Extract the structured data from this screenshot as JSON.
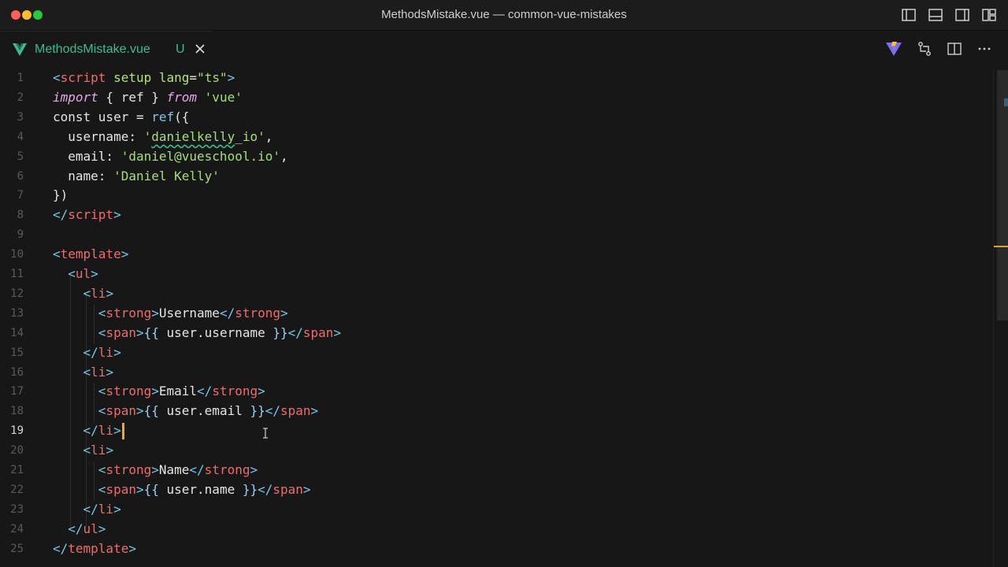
{
  "window": {
    "title": "MethodsMistake.vue — common-vue-mistakes",
    "controls": [
      "close",
      "minimize",
      "maximize"
    ],
    "layout_icons": [
      "toggle-primary-sidebar-icon",
      "toggle-panel-icon",
      "toggle-secondary-sidebar-icon",
      "customize-layout-icon"
    ]
  },
  "tab": {
    "filename": "MethodsMistake.vue",
    "status": "U",
    "icon": "vue-icon",
    "accent": "#3dbd8c"
  },
  "tab_actions": [
    "vite-icon",
    "open-changes-icon",
    "split-editor-icon",
    "more-actions-icon"
  ],
  "editor": {
    "active_line": 19,
    "lines": [
      {
        "n": "1",
        "tokens": [
          [
            "t-tag",
            "<"
          ],
          [
            "t-name",
            "script"
          ],
          [
            "t-plain",
            " "
          ],
          [
            "t-attr",
            "setup"
          ],
          [
            "t-plain",
            " "
          ],
          [
            "t-attr",
            "lang"
          ],
          [
            "t-plain",
            "="
          ],
          [
            "t-str",
            "\"ts\""
          ],
          [
            "t-tag",
            ">"
          ]
        ]
      },
      {
        "n": "2",
        "tokens": [
          [
            "t-kw",
            "import"
          ],
          [
            "t-plain",
            " { ref } "
          ],
          [
            "t-kw",
            "from"
          ],
          [
            "t-plain",
            " "
          ],
          [
            "t-str",
            "'vue'"
          ]
        ]
      },
      {
        "n": "3",
        "tokens": [
          [
            "t-plain",
            "const user = "
          ],
          [
            "t-fn",
            "ref"
          ],
          [
            "t-plain",
            "({"
          ]
        ]
      },
      {
        "n": "4",
        "tokens": [
          [
            "t-plain",
            "  username: "
          ],
          [
            "t-str",
            "'"
          ],
          [
            "t-str squiggle",
            "danielkelly"
          ],
          [
            "t-str",
            "_io'"
          ],
          [
            "t-plain",
            ","
          ]
        ]
      },
      {
        "n": "5",
        "tokens": [
          [
            "t-plain",
            "  email: "
          ],
          [
            "t-str",
            "'daniel@vueschool.io'"
          ],
          [
            "t-plain",
            ","
          ]
        ]
      },
      {
        "n": "6",
        "tokens": [
          [
            "t-plain",
            "  name: "
          ],
          [
            "t-str",
            "'Daniel Kelly'"
          ]
        ]
      },
      {
        "n": "7",
        "tokens": [
          [
            "t-plain",
            "})"
          ]
        ]
      },
      {
        "n": "8",
        "tokens": [
          [
            "t-tag",
            "</"
          ],
          [
            "t-name",
            "script"
          ],
          [
            "t-tag",
            ">"
          ]
        ]
      },
      {
        "n": "9",
        "tokens": []
      },
      {
        "n": "10",
        "tokens": [
          [
            "t-tag",
            "<"
          ],
          [
            "t-name",
            "template"
          ],
          [
            "t-tag",
            ">"
          ]
        ]
      },
      {
        "n": "11",
        "tokens": [
          [
            "t-plain",
            "  "
          ],
          [
            "t-tag",
            "<"
          ],
          [
            "t-name",
            "ul"
          ],
          [
            "t-tag",
            ">"
          ]
        ]
      },
      {
        "n": "12",
        "tokens": [
          [
            "t-plain",
            "    "
          ],
          [
            "t-tag",
            "<"
          ],
          [
            "t-name",
            "li"
          ],
          [
            "t-tag",
            ">"
          ]
        ]
      },
      {
        "n": "13",
        "tokens": [
          [
            "t-plain",
            "      "
          ],
          [
            "t-tag",
            "<"
          ],
          [
            "t-name",
            "strong"
          ],
          [
            "t-tag",
            ">"
          ],
          [
            "t-plain",
            "Username"
          ],
          [
            "t-tag",
            "</"
          ],
          [
            "t-name",
            "strong"
          ],
          [
            "t-tag",
            ">"
          ]
        ]
      },
      {
        "n": "14",
        "tokens": [
          [
            "t-plain",
            "      "
          ],
          [
            "t-tag",
            "<"
          ],
          [
            "t-name",
            "span"
          ],
          [
            "t-tag",
            ">"
          ],
          [
            "t-punc",
            "{{"
          ],
          [
            "t-plain",
            " user.username "
          ],
          [
            "t-punc",
            "}}"
          ],
          [
            "t-tag",
            "</"
          ],
          [
            "t-name",
            "span"
          ],
          [
            "t-tag",
            ">"
          ]
        ]
      },
      {
        "n": "15",
        "tokens": [
          [
            "t-plain",
            "    "
          ],
          [
            "t-tag",
            "</"
          ],
          [
            "t-name",
            "li"
          ],
          [
            "t-tag",
            ">"
          ]
        ]
      },
      {
        "n": "16",
        "tokens": [
          [
            "t-plain",
            "    "
          ],
          [
            "t-tag",
            "<"
          ],
          [
            "t-name",
            "li"
          ],
          [
            "t-tag",
            ">"
          ]
        ]
      },
      {
        "n": "17",
        "tokens": [
          [
            "t-plain",
            "      "
          ],
          [
            "t-tag",
            "<"
          ],
          [
            "t-name",
            "strong"
          ],
          [
            "t-tag",
            ">"
          ],
          [
            "t-plain",
            "Email"
          ],
          [
            "t-tag",
            "</"
          ],
          [
            "t-name",
            "strong"
          ],
          [
            "t-tag",
            ">"
          ]
        ]
      },
      {
        "n": "18",
        "tokens": [
          [
            "t-plain",
            "      "
          ],
          [
            "t-tag",
            "<"
          ],
          [
            "t-name",
            "span"
          ],
          [
            "t-tag",
            ">"
          ],
          [
            "t-punc",
            "{{"
          ],
          [
            "t-plain",
            " user.email "
          ],
          [
            "t-punc",
            "}}"
          ],
          [
            "t-tag",
            "</"
          ],
          [
            "t-name",
            "span"
          ],
          [
            "t-tag",
            ">"
          ]
        ]
      },
      {
        "n": "19",
        "tokens": [
          [
            "t-plain",
            "    "
          ],
          [
            "t-tag",
            "</"
          ],
          [
            "t-name",
            "li"
          ],
          [
            "t-tag",
            ">"
          ]
        ]
      },
      {
        "n": "20",
        "tokens": [
          [
            "t-plain",
            "    "
          ],
          [
            "t-tag",
            "<"
          ],
          [
            "t-name",
            "li"
          ],
          [
            "t-tag",
            ">"
          ]
        ]
      },
      {
        "n": "21",
        "tokens": [
          [
            "t-plain",
            "      "
          ],
          [
            "t-tag",
            "<"
          ],
          [
            "t-name",
            "strong"
          ],
          [
            "t-tag",
            ">"
          ],
          [
            "t-plain",
            "Name"
          ],
          [
            "t-tag",
            "</"
          ],
          [
            "t-name",
            "strong"
          ],
          [
            "t-tag",
            ">"
          ]
        ]
      },
      {
        "n": "22",
        "tokens": [
          [
            "t-plain",
            "      "
          ],
          [
            "t-tag",
            "<"
          ],
          [
            "t-name",
            "span"
          ],
          [
            "t-tag",
            ">"
          ],
          [
            "t-punc",
            "{{"
          ],
          [
            "t-plain",
            " user.name "
          ],
          [
            "t-punc",
            "}}"
          ],
          [
            "t-tag",
            "</"
          ],
          [
            "t-name",
            "span"
          ],
          [
            "t-tag",
            ">"
          ]
        ]
      },
      {
        "n": "23",
        "tokens": [
          [
            "t-plain",
            "    "
          ],
          [
            "t-tag",
            "</"
          ],
          [
            "t-name",
            "li"
          ],
          [
            "t-tag",
            ">"
          ]
        ]
      },
      {
        "n": "24",
        "tokens": [
          [
            "t-plain",
            "  "
          ],
          [
            "t-tag",
            "</"
          ],
          [
            "t-name",
            "ul"
          ],
          [
            "t-tag",
            ">"
          ]
        ]
      },
      {
        "n": "25",
        "tokens": [
          [
            "t-tag",
            "</"
          ],
          [
            "t-name",
            "template"
          ],
          [
            "t-tag",
            ">"
          ]
        ]
      }
    ]
  }
}
